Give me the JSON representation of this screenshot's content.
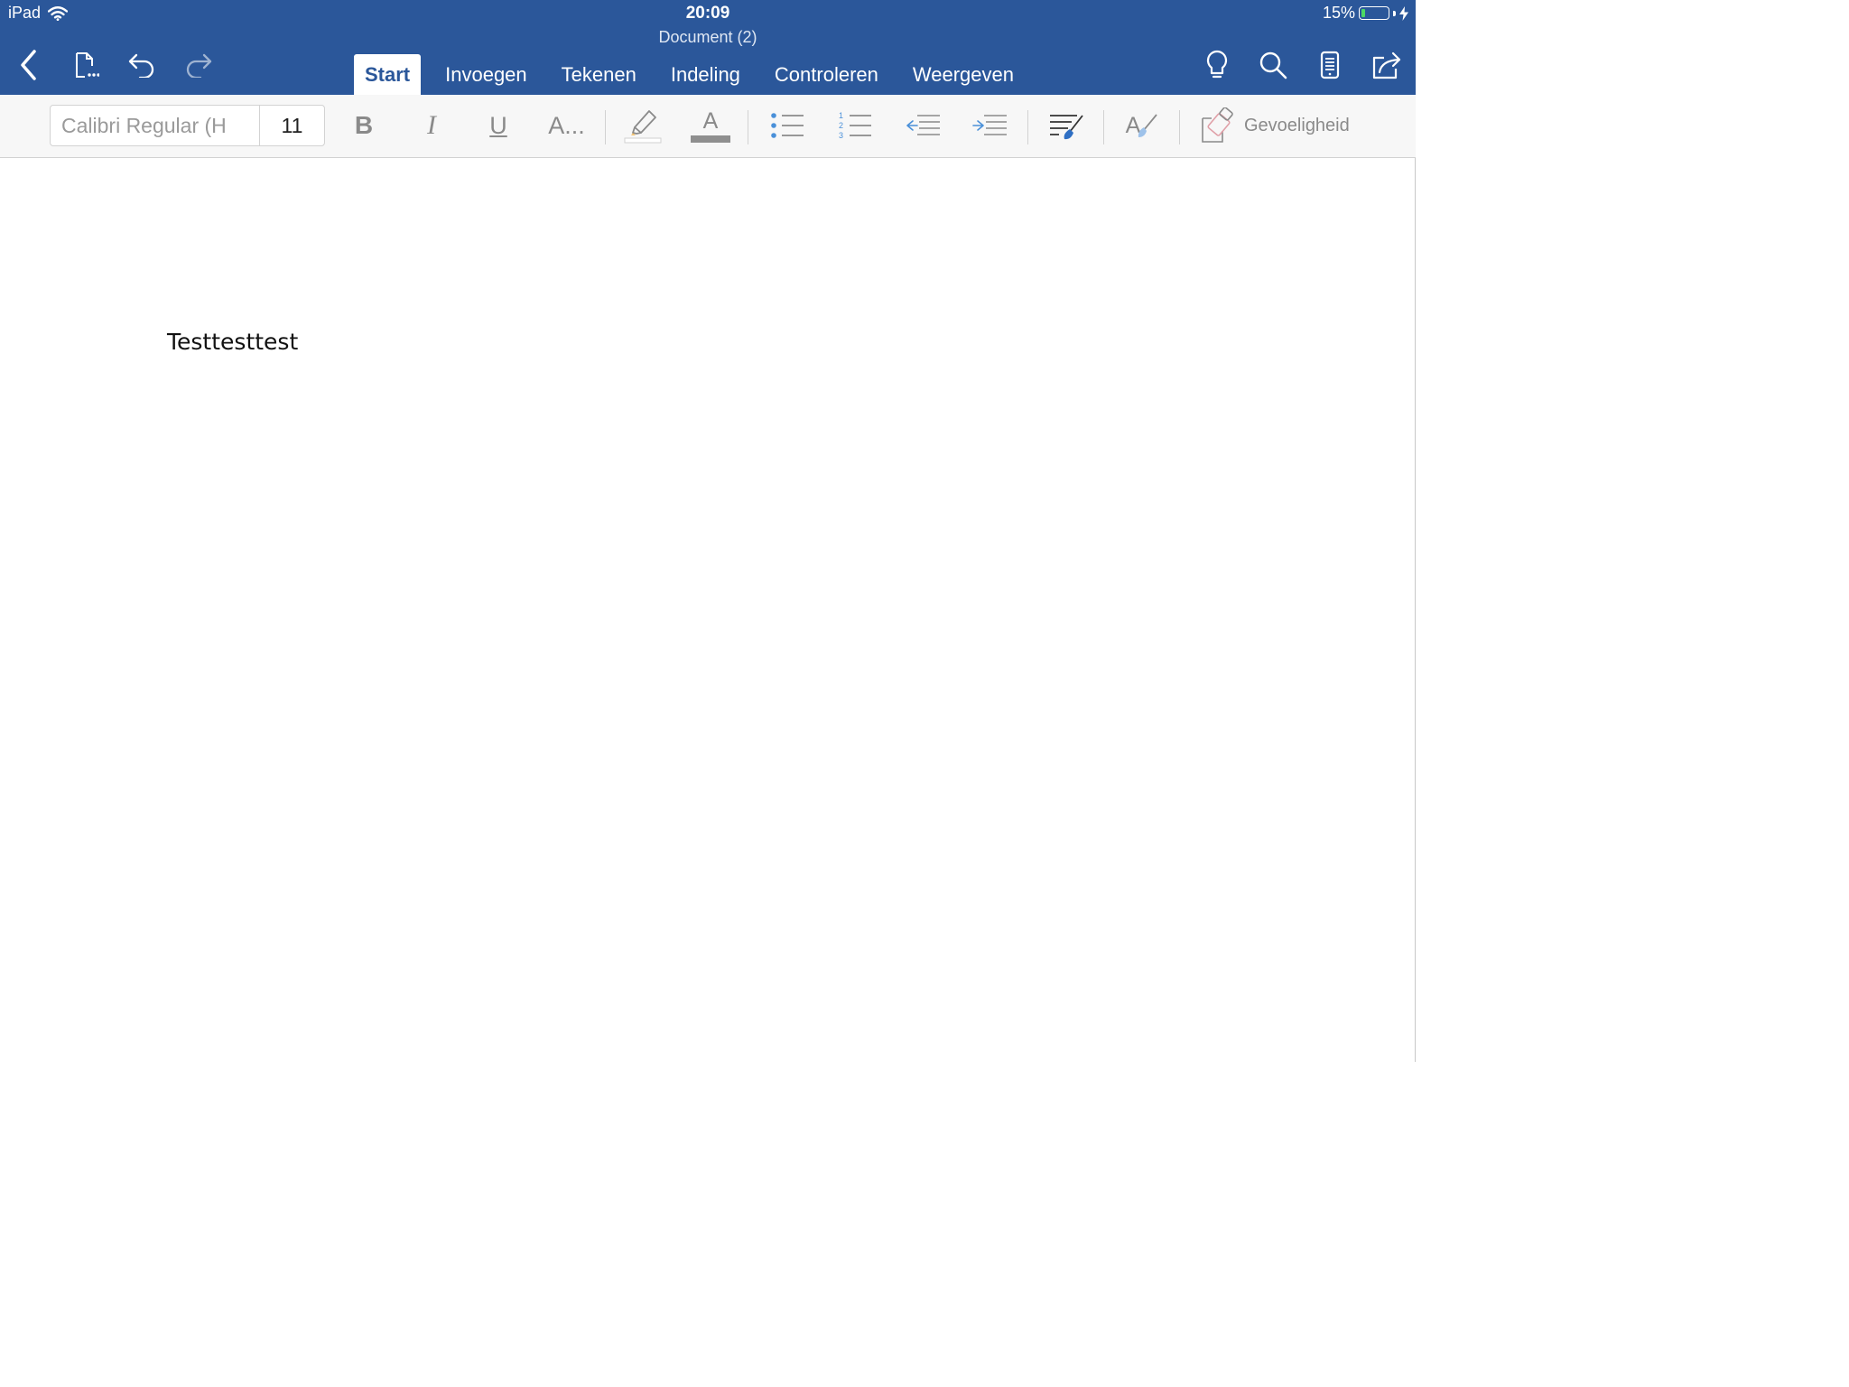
{
  "status_bar": {
    "device": "iPad",
    "time": "20:09",
    "battery_percent": "15%",
    "battery_level": 0.15,
    "icons": [
      "wifi-icon",
      "battery-icon",
      "charging-bolt-icon"
    ]
  },
  "header": {
    "document_title": "Document (2)",
    "left_icons": [
      "back-chevron-icon",
      "file-menu-icon",
      "undo-icon",
      "redo-icon"
    ],
    "right_icons": [
      "lightbulb-icon",
      "search-icon",
      "mobile-view-icon",
      "share-icon"
    ]
  },
  "tabs": [
    {
      "label": "Start",
      "active": true
    },
    {
      "label": "Invoegen",
      "active": false
    },
    {
      "label": "Tekenen",
      "active": false
    },
    {
      "label": "Indeling",
      "active": false
    },
    {
      "label": "Controleren",
      "active": false
    },
    {
      "label": "Weergeven",
      "active": false
    }
  ],
  "ribbon": {
    "font_name": "Calibri Regular (H",
    "font_size": "11",
    "bold_label": "B",
    "italic_label": "I",
    "underline_label": "U",
    "more_format_label": "A...",
    "font_color_label": "A",
    "styles_label": "A",
    "sensitivity_label": "Gevoeligheid",
    "icons": [
      "highlighter-icon",
      "font-color-icon",
      "bullet-list-icon",
      "numbered-list-icon",
      "decrease-indent-icon",
      "increase-indent-icon",
      "paragraph-styles-icon",
      "styles-brush-icon",
      "sensitivity-icon"
    ]
  },
  "document": {
    "body_text": "Testtesttest"
  },
  "colors": {
    "brand": "#2b579a",
    "ribbon_bg": "#f7f7f7",
    "accent_blue": "#4a90d9"
  }
}
